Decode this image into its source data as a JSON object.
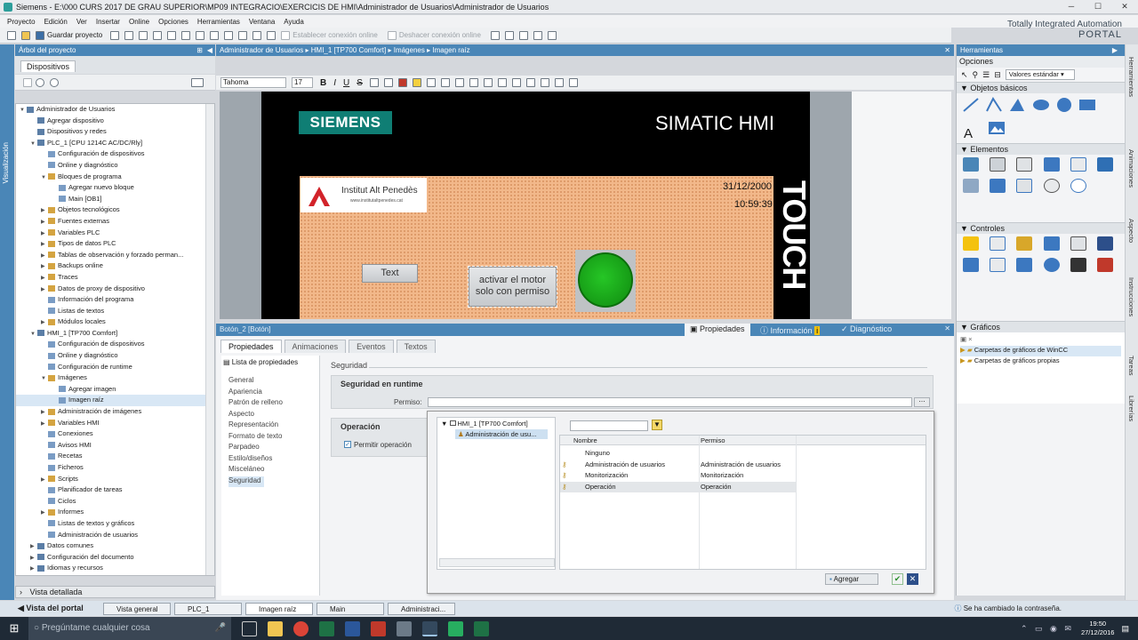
{
  "window": {
    "title": "Siemens - E:\\000 CURS 2017 DE GRAU SUPERIOR\\MP09 INTEGRACIO\\EXERCICIS DE HMI\\Administrador de Usuarios\\Administrador de Usuarios"
  },
  "menu": [
    "Proyecto",
    "Edición",
    "Ver",
    "Insertar",
    "Online",
    "Opciones",
    "Herramientas",
    "Ventana",
    "Ayuda"
  ],
  "toolbar": {
    "save_label": "Guardar proyecto",
    "connect_label": "Establecer conexión online",
    "disconnect_label": "Deshacer conexión online"
  },
  "branding": {
    "line1": "Totally Integrated Automation",
    "line2": "PORTAL"
  },
  "project_tree": {
    "header": "Árbol del proyecto",
    "tab": "Dispositivos",
    "side_label": "Visualización",
    "items": [
      {
        "label": "Administrador de Usuarios",
        "level": 0,
        "arrow": "▼"
      },
      {
        "label": "Agregar dispositivo",
        "level": 1,
        "arrow": ""
      },
      {
        "label": "Dispositivos y redes",
        "level": 1,
        "arrow": ""
      },
      {
        "label": "PLC_1 [CPU 1214C AC/DC/Rly]",
        "level": 1,
        "arrow": "▼"
      },
      {
        "label": "Configuración de dispositivos",
        "level": 2,
        "arrow": ""
      },
      {
        "label": "Online y diagnóstico",
        "level": 2,
        "arrow": ""
      },
      {
        "label": "Bloques de programa",
        "level": 2,
        "arrow": "▼"
      },
      {
        "label": "Agregar nuevo bloque",
        "level": 3,
        "arrow": ""
      },
      {
        "label": "Main [OB1]",
        "level": 3,
        "arrow": ""
      },
      {
        "label": "Objetos tecnológicos",
        "level": 2,
        "arrow": "▶"
      },
      {
        "label": "Fuentes externas",
        "level": 2,
        "arrow": "▶"
      },
      {
        "label": "Variables PLC",
        "level": 2,
        "arrow": "▶"
      },
      {
        "label": "Tipos de datos PLC",
        "level": 2,
        "arrow": "▶"
      },
      {
        "label": "Tablas de observación y forzado perman...",
        "level": 2,
        "arrow": "▶"
      },
      {
        "label": "Backups online",
        "level": 2,
        "arrow": "▶"
      },
      {
        "label": "Traces",
        "level": 2,
        "arrow": "▶"
      },
      {
        "label": "Datos de proxy de dispositivo",
        "level": 2,
        "arrow": "▶"
      },
      {
        "label": "Información del programa",
        "level": 2,
        "arrow": ""
      },
      {
        "label": "Listas de textos",
        "level": 2,
        "arrow": ""
      },
      {
        "label": "Módulos locales",
        "level": 2,
        "arrow": "▶"
      },
      {
        "label": "HMI_1 [TP700 Comfort]",
        "level": 1,
        "arrow": "▼"
      },
      {
        "label": "Configuración de dispositivos",
        "level": 2,
        "arrow": ""
      },
      {
        "label": "Online y diagnóstico",
        "level": 2,
        "arrow": ""
      },
      {
        "label": "Configuración de runtime",
        "level": 2,
        "arrow": ""
      },
      {
        "label": "Imágenes",
        "level": 2,
        "arrow": "▼"
      },
      {
        "label": "Agregar imagen",
        "level": 3,
        "arrow": ""
      },
      {
        "label": "Imagen raíz",
        "level": 3,
        "arrow": ""
      },
      {
        "label": "Administración de imágenes",
        "level": 2,
        "arrow": "▶"
      },
      {
        "label": "Variables HMI",
        "level": 2,
        "arrow": "▶"
      },
      {
        "label": "Conexiones",
        "level": 2,
        "arrow": ""
      },
      {
        "label": "Avisos HMI",
        "level": 2,
        "arrow": ""
      },
      {
        "label": "Recetas",
        "level": 2,
        "arrow": ""
      },
      {
        "label": "Ficheros",
        "level": 2,
        "arrow": ""
      },
      {
        "label": "Scripts",
        "level": 2,
        "arrow": "▶"
      },
      {
        "label": "Planificador de tareas",
        "level": 2,
        "arrow": ""
      },
      {
        "label": "Ciclos",
        "level": 2,
        "arrow": ""
      },
      {
        "label": "Informes",
        "level": 2,
        "arrow": "▶"
      },
      {
        "label": "Listas de textos y gráficos",
        "level": 2,
        "arrow": ""
      },
      {
        "label": "Administración de usuarios",
        "level": 2,
        "arrow": ""
      },
      {
        "label": "Datos comunes",
        "level": 1,
        "arrow": "▶"
      },
      {
        "label": "Configuración del documento",
        "level": 1,
        "arrow": "▶"
      },
      {
        "label": "Idiomas y recursos",
        "level": 1,
        "arrow": "▶"
      }
    ],
    "detail": "Vista detallada"
  },
  "editor": {
    "breadcrumb": [
      "Administrador de Usuarios",
      "HMI_1 [TP700 Comfort]",
      "Imágenes",
      "Imagen raíz"
    ],
    "font": "Tahoma",
    "font_size": "17",
    "hmi": {
      "brand": "SIEMENS",
      "product": "SIMATIC HMI",
      "logo_name": "Institut Alt Penedès",
      "logo_url": "www.institutaltpenedes.cat",
      "date": "31/12/2000",
      "time": "10:59:39",
      "touch": "TOUCH",
      "button_text": "Text",
      "button_motor": "activar el motor solo con permiso"
    }
  },
  "properties": {
    "title": "Botón_2 [Botón]",
    "right_tabs": [
      "Propiedades",
      "Información",
      "Diagnóstico"
    ],
    "tabs": [
      "Propiedades",
      "Animaciones",
      "Eventos",
      "Textos"
    ],
    "list_label": "Lista de propiedades",
    "list": [
      "General",
      "Apariencia",
      "Patrón de relleno",
      "Aspecto",
      "Representación",
      "Formato de texto",
      "Parpadeo",
      "Estilo/diseños",
      "Misceláneo",
      "Seguridad"
    ],
    "section": "Seguridad",
    "runtime_title": "Seguridad en runtime",
    "permiso_label": "Permiso:",
    "operation_title": "Operación",
    "allow_operation": "Permitir operación"
  },
  "permission_dialog": {
    "tree_root": "HMI_1 [TP700 Comfort]",
    "tree_child": "Administración de usu...",
    "columns": [
      "Nombre",
      "Permiso"
    ],
    "rows": [
      {
        "name": "Ninguno",
        "perm": ""
      },
      {
        "name": "Administración de usuarios",
        "perm": "Administración de usuarios"
      },
      {
        "name": "Monitorización",
        "perm": "Monitorización"
      },
      {
        "name": "Operación",
        "perm": "Operación"
      }
    ],
    "add_button": "Agregar"
  },
  "tools": {
    "header": "Herramientas",
    "options": "Opciones",
    "preset": "Valores estándar",
    "sections": [
      "Objetos básicos",
      "Elementos",
      "Controles",
      "Gráficos"
    ],
    "graphics": [
      "Carpetas de gráficos de WinCC",
      "Carpetas de gráficos propias"
    ],
    "side_tabs": [
      "Herramientas",
      "Animaciones",
      "Aspecto",
      "Instrucciones",
      "Tareas",
      "Librerías"
    ]
  },
  "bottom_tabs": {
    "portal": "Vista del portal",
    "tabs": [
      "Vista general",
      "PLC_1",
      "Imagen raíz",
      "Main",
      "Administraci..."
    ],
    "status": "Se ha cambiado la contraseña."
  },
  "os_taskbar": {
    "search": "Pregúntame cualquier cosa",
    "time": "19:50",
    "date": "27/12/2016"
  }
}
